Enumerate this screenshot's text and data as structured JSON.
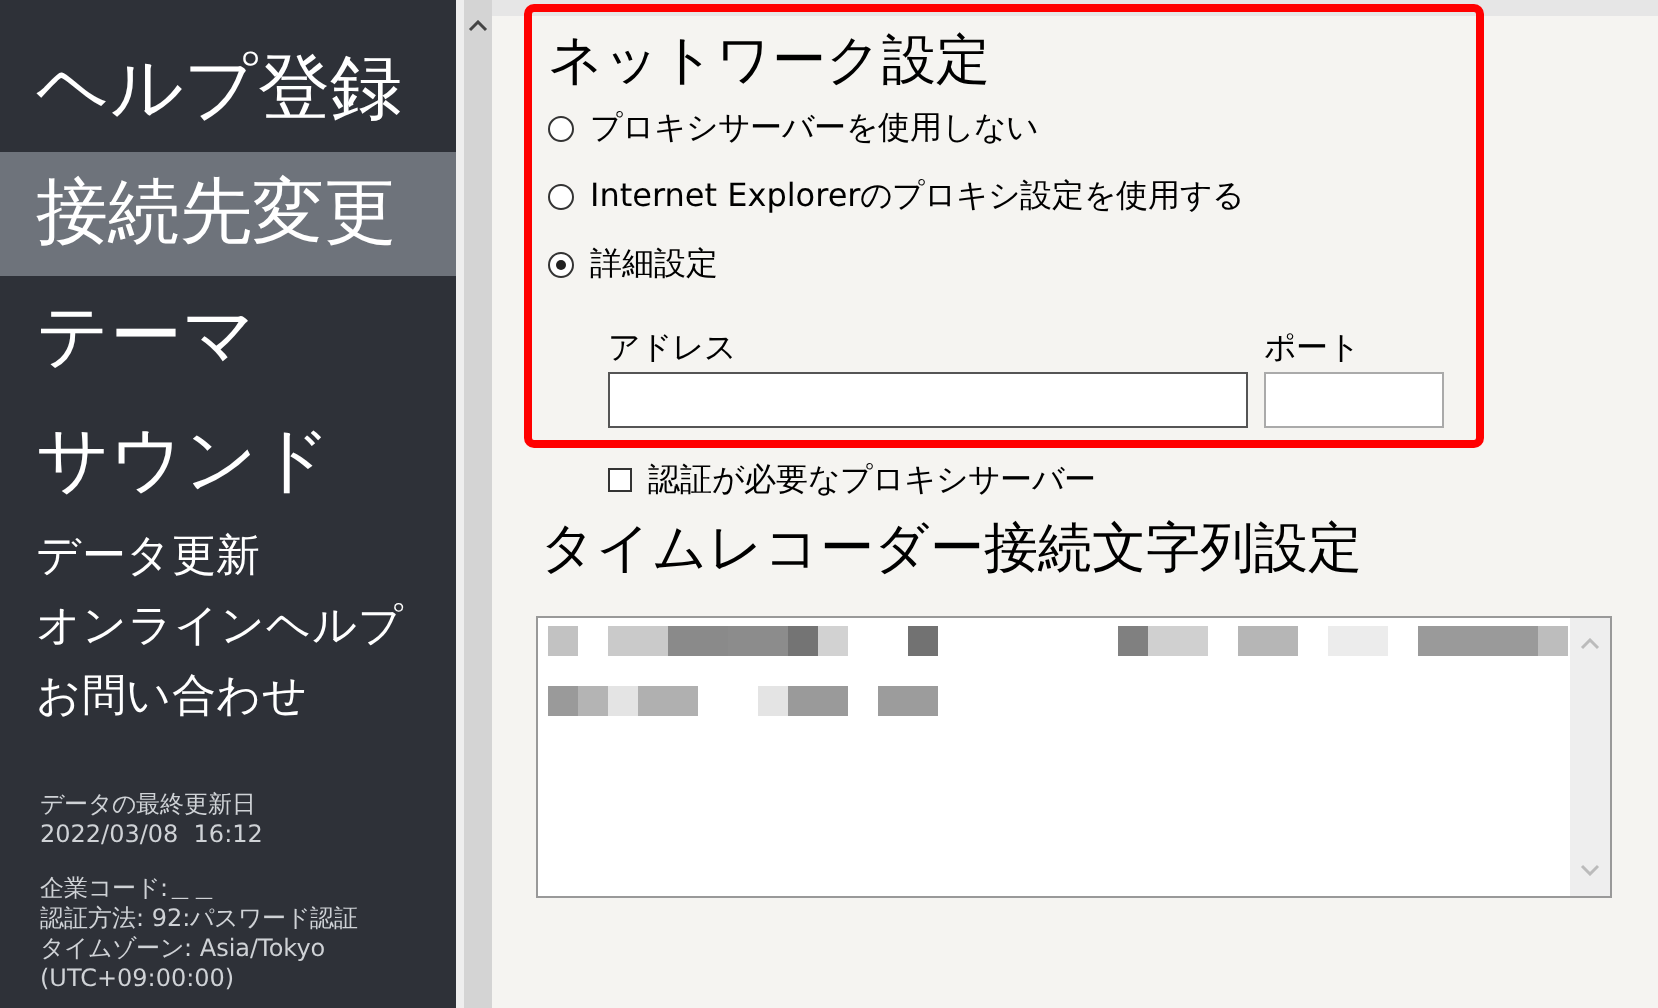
{
  "sidebar": {
    "items": [
      {
        "label": "ヘルプ登録",
        "kind": "large",
        "selected": false
      },
      {
        "label": "接続先変更",
        "kind": "large",
        "selected": true
      },
      {
        "label": "テーマ",
        "kind": "large",
        "selected": false
      },
      {
        "label": "サウンド",
        "kind": "large",
        "selected": false
      },
      {
        "label": "データ更新",
        "kind": "small",
        "selected": false
      },
      {
        "label": "オンラインヘルプ",
        "kind": "small",
        "selected": false
      },
      {
        "label": "お問い合わせ",
        "kind": "small",
        "selected": false
      }
    ],
    "info_groups": [
      [
        "データの最終更新日",
        "2022/03/08  16:12"
      ],
      [
        "企業コード:＿＿",
        "認証方法: 92:パスワード認証",
        "タイムゾーン: Asia/Tokyo",
        "(UTC+09:00:00)"
      ]
    ]
  },
  "network": {
    "title": "ネットワーク設定",
    "radios": [
      {
        "label": "プロキシサーバーを使用しない",
        "selected": false
      },
      {
        "label": "Internet Explorerのプロキシ設定を使用する",
        "selected": false
      },
      {
        "label": "詳細設定",
        "selected": true
      }
    ],
    "address": {
      "label": "アドレス"
    },
    "port": {
      "label": "ポート"
    },
    "auth_checkbox": {
      "label": "認証が必要なプロキシサーバー",
      "checked": false
    }
  },
  "timerecorder": {
    "title": "タイムレコーダー接続文字列設定"
  }
}
